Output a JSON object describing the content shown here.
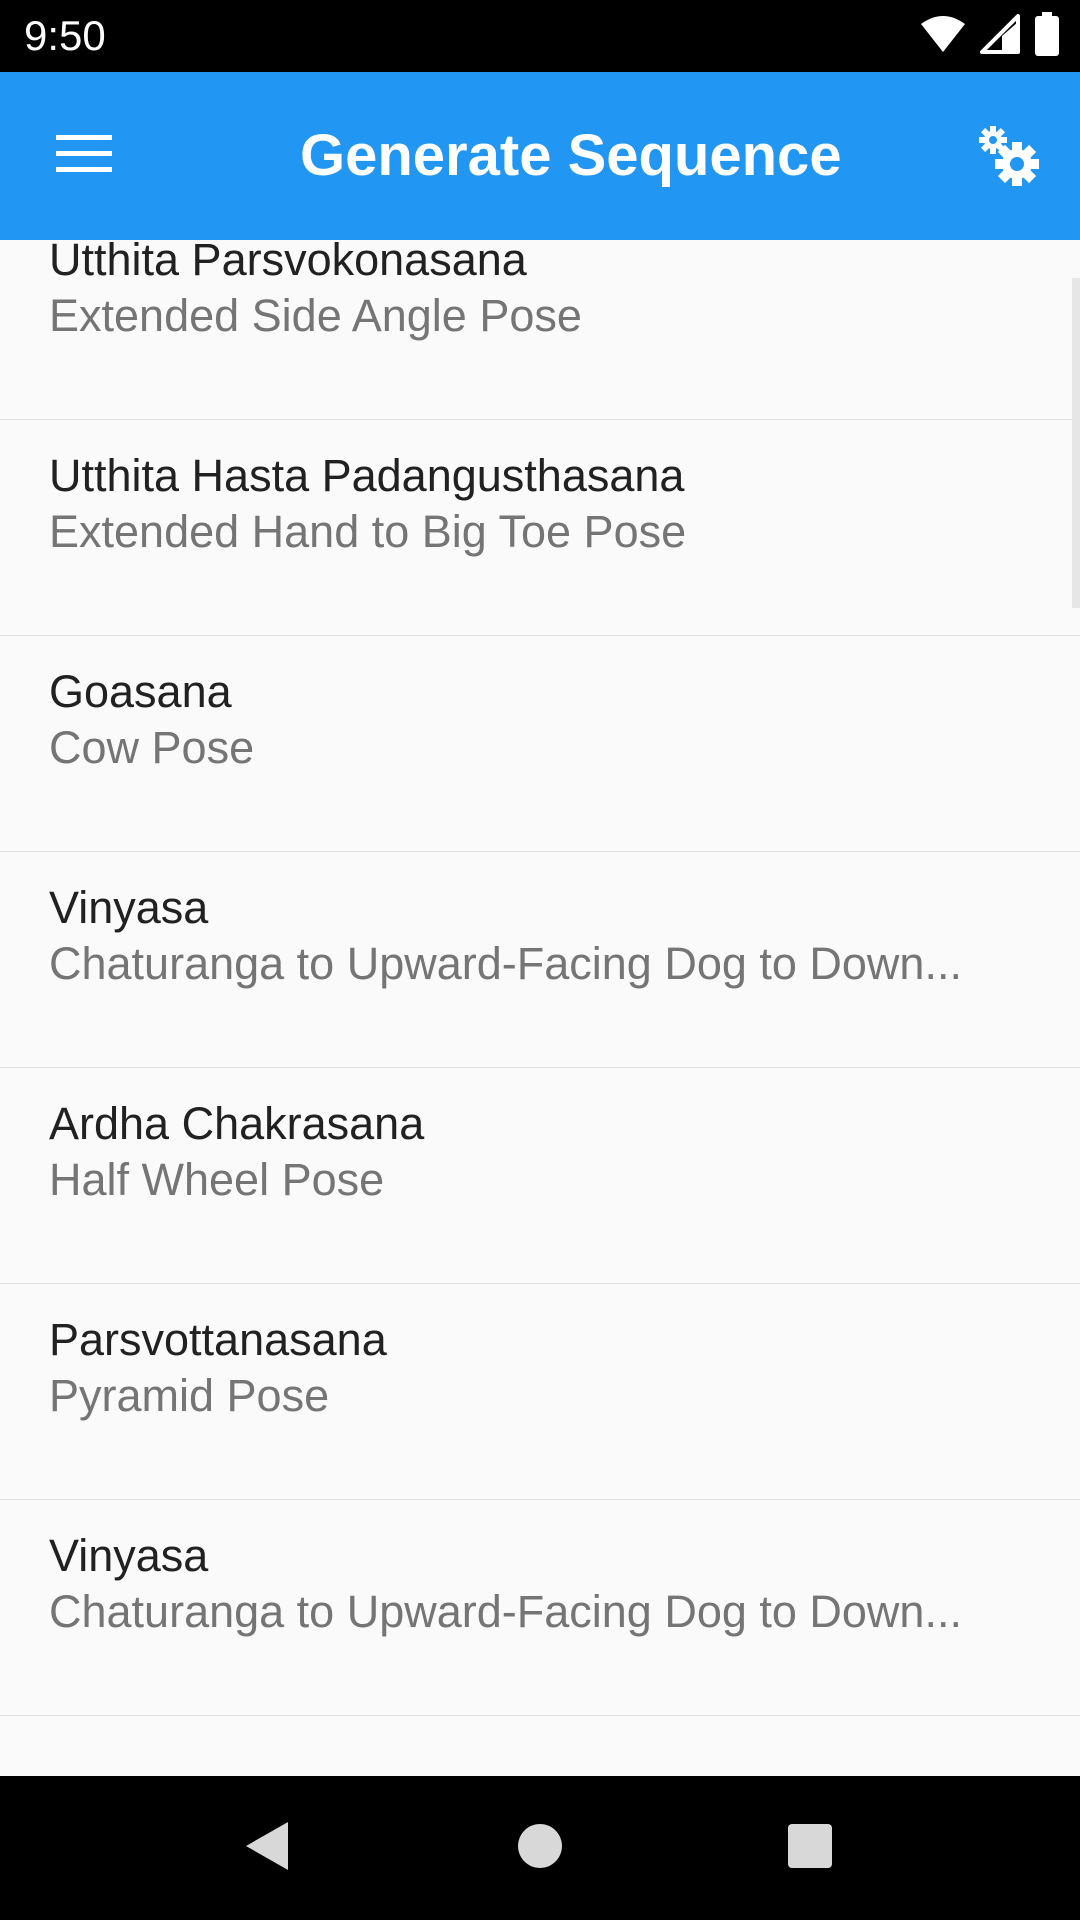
{
  "status_bar": {
    "time": "9:50",
    "icons": [
      "wifi-icon",
      "cellular-signal-icon",
      "battery-icon"
    ]
  },
  "app_bar": {
    "title": "Generate Sequence",
    "menu_icon": "hamburger-menu-icon",
    "settings_icon": "settings-gears-icon",
    "background_color": "#2196f3"
  },
  "poses": [
    {
      "name": "Utthita Parsvokonasana",
      "description": "Extended Side Angle Pose"
    },
    {
      "name": "Utthita Hasta Padangusthasana",
      "description": "Extended Hand to Big Toe Pose"
    },
    {
      "name": "Goasana",
      "description": "Cow Pose"
    },
    {
      "name": "Vinyasa",
      "description": "Chaturanga to Upward-Facing Dog to Down..."
    },
    {
      "name": "Ardha Chakrasana",
      "description": "Half Wheel Pose"
    },
    {
      "name": "Parsvottanasana",
      "description": "Pyramid Pose"
    },
    {
      "name": "Vinyasa",
      "description": "Chaturanga to Upward-Facing Dog to Down..."
    }
  ],
  "nav_bar": {
    "icons": [
      "back-icon",
      "home-icon",
      "recents-icon"
    ]
  }
}
